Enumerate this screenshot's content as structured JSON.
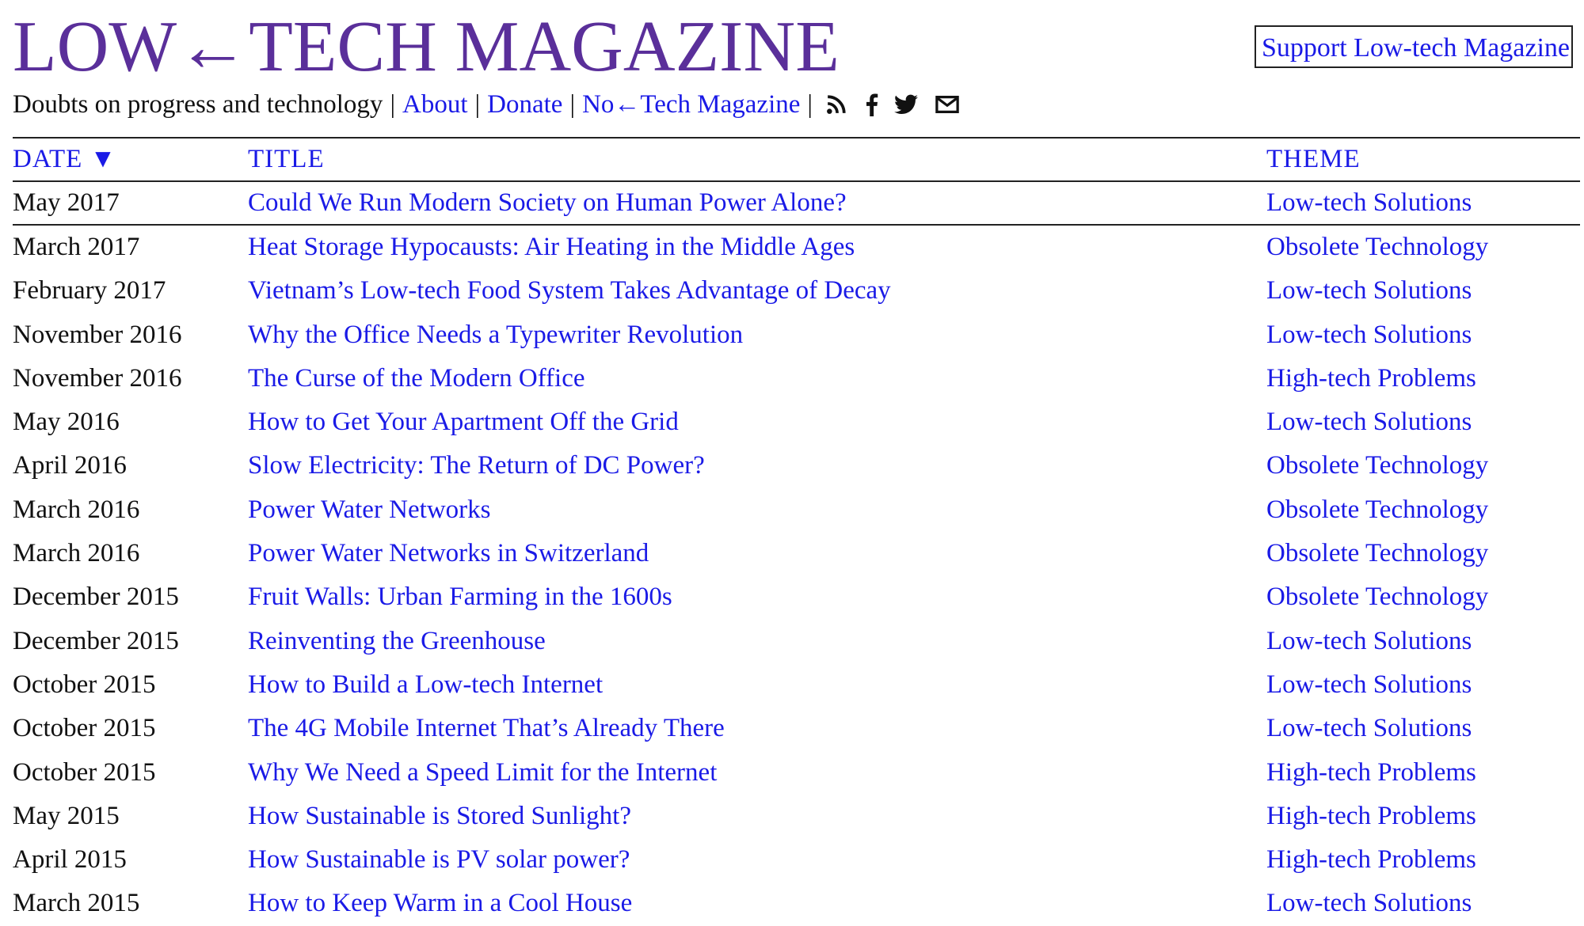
{
  "header": {
    "title": "LOW←TECH MAGAZINE",
    "support_label": "Support Low-tech Magazine",
    "tagline": "Doubts on progress and technology",
    "separator": "|",
    "nav": [
      {
        "label": "About"
      },
      {
        "label": "Donate"
      },
      {
        "label": "No←Tech Magazine"
      }
    ],
    "social_icons": [
      "rss-icon",
      "facebook-icon",
      "twitter-icon",
      "mail-icon"
    ]
  },
  "colors": {
    "masthead": "#5a2f9a",
    "link": "#1a1ae6",
    "text": "#111111",
    "rule": "#222222"
  },
  "table": {
    "headers": {
      "date": "DATE ▼",
      "title": "TITLE",
      "theme": "THEME"
    },
    "rows": [
      {
        "date": "May 2017",
        "title": "Could We Run Modern Society on Human Power Alone?",
        "theme": "Low-tech Solutions"
      },
      {
        "date": "March 2017",
        "title": "Heat Storage Hypocausts: Air Heating in the Middle Ages",
        "theme": "Obsolete Technology"
      },
      {
        "date": "February 2017",
        "title": "Vietnam’s Low-tech Food System Takes Advantage of Decay",
        "theme": "Low-tech Solutions"
      },
      {
        "date": "November 2016",
        "title": "Why the Office Needs a Typewriter Revolution",
        "theme": "Low-tech Solutions"
      },
      {
        "date": "November 2016",
        "title": "The Curse of the Modern Office",
        "theme": "High-tech Problems"
      },
      {
        "date": "May 2016",
        "title": "How to Get Your Apartment Off the Grid",
        "theme": "Low-tech Solutions"
      },
      {
        "date": "April 2016",
        "title": "Slow Electricity: The Return of DC Power?",
        "theme": "Obsolete Technology"
      },
      {
        "date": "March 2016",
        "title": "Power Water Networks",
        "theme": "Obsolete Technology"
      },
      {
        "date": "March 2016",
        "title": "Power Water Networks in Switzerland",
        "theme": "Obsolete Technology"
      },
      {
        "date": "December 2015",
        "title": "Fruit Walls: Urban Farming in the 1600s",
        "theme": "Obsolete Technology"
      },
      {
        "date": "December 2015",
        "title": "Reinventing the Greenhouse",
        "theme": "Low-tech Solutions"
      },
      {
        "date": "October 2015",
        "title": "How to Build a Low-tech Internet",
        "theme": "Low-tech Solutions"
      },
      {
        "date": "October 2015",
        "title": "The 4G Mobile Internet That’s Already There",
        "theme": "Low-tech Solutions"
      },
      {
        "date": "October 2015",
        "title": "Why We Need a Speed Limit for the Internet",
        "theme": "High-tech Problems"
      },
      {
        "date": "May 2015",
        "title": "How Sustainable is Stored Sunlight?",
        "theme": "High-tech Problems"
      },
      {
        "date": "April 2015",
        "title": "How Sustainable is PV solar power?",
        "theme": "High-tech Problems"
      },
      {
        "date": "March 2015",
        "title": "How to Keep Warm in a Cool House",
        "theme": "Low-tech Solutions"
      }
    ]
  }
}
